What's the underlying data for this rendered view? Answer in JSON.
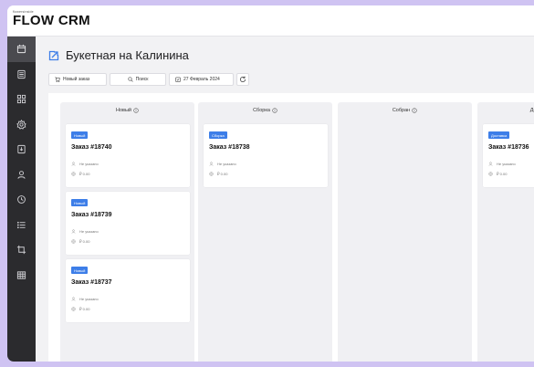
{
  "app": {
    "logo_small": "flowersinside",
    "logo_main": "FLOW CRM"
  },
  "sidebar": {
    "items": [
      {
        "icon": "calendar-icon",
        "active": true
      },
      {
        "icon": "list-icon",
        "active": false
      },
      {
        "icon": "grid-icon",
        "active": false
      },
      {
        "icon": "gear-icon",
        "active": false
      },
      {
        "icon": "export-icon",
        "active": false
      },
      {
        "icon": "user-icon",
        "active": false
      },
      {
        "icon": "history-icon",
        "active": false
      },
      {
        "icon": "menu-list-icon",
        "active": false
      },
      {
        "icon": "crop-icon",
        "active": false
      },
      {
        "icon": "table-icon",
        "active": false
      }
    ]
  },
  "page": {
    "title": "Букетная на Калинина"
  },
  "toolbar": {
    "new_order": "Новый заказ",
    "search": "Поиск",
    "date": "27 Февраль 2024"
  },
  "columns": [
    {
      "title": "Новый",
      "cards": [
        {
          "badge": "Новый",
          "title": "Заказ #18740",
          "customer": "Не указано",
          "amount": "₽ 0.00"
        },
        {
          "badge": "Новый",
          "title": "Заказ #18739",
          "customer": "Не указано",
          "amount": "₽ 0.00"
        },
        {
          "badge": "Новый",
          "title": "Заказ #18737",
          "customer": "Не указано",
          "amount": "₽ 0.00"
        }
      ]
    },
    {
      "title": "Сборка",
      "cards": [
        {
          "badge": "Сборка",
          "title": "Заказ #18738",
          "customer": "Не указано",
          "amount": "₽ 0.00"
        }
      ]
    },
    {
      "title": "Собран",
      "cards": []
    },
    {
      "title": "Доставка",
      "cards": [
        {
          "badge": "Доставка",
          "title": "Заказ #18736",
          "customer": "Не указано",
          "amount": "₽ 0.00"
        }
      ]
    }
  ],
  "colors": {
    "accent": "#3d7ee8",
    "sidebar": "#2b2b2e",
    "background": "#cfc3f2"
  }
}
